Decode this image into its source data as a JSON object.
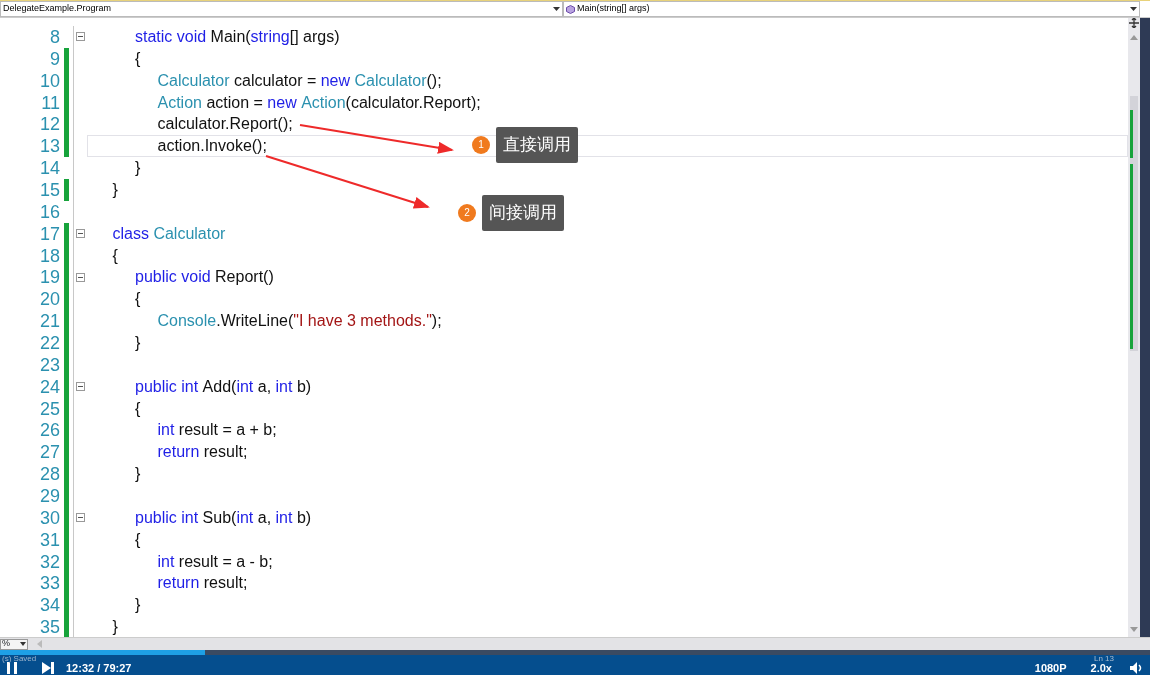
{
  "navigation_bar": {
    "type_dropdown": {
      "value": "DelegateExample.Program"
    },
    "member_dropdown": {
      "value": "Main(string[] args)"
    }
  },
  "code_lines": [
    {
      "children": [
        {
          "number": "8",
          "changed": false,
          "foldable": true,
          "current": false,
          "tokens": [
            {
              "text": "static void ",
              "kind": "keyword"
            },
            {
              "text": "Main(",
              "kind": "plain"
            },
            {
              "text": "string",
              "kind": "keyword"
            },
            {
              "text": "[] args)",
              "kind": "plain"
            }
          ]
        },
        {
          "number": "9",
          "changed": true,
          "foldable": false,
          "current": false,
          "tokens": [
            {
              "text": "{",
              "kind": "plain"
            }
          ],
          "children": [
            {
              "number": "10",
              "changed": true,
              "foldable": false,
              "current": false,
              "tokens": [
                {
                  "text": "Calculator",
                  "kind": "type"
                },
                {
                  "text": " calculator = ",
                  "kind": "plain"
                },
                {
                  "text": "new ",
                  "kind": "keyword"
                },
                {
                  "text": "Calculator",
                  "kind": "type"
                },
                {
                  "text": "();",
                  "kind": "plain"
                }
              ]
            },
            {
              "number": "11",
              "changed": true,
              "foldable": false,
              "current": false,
              "tokens": [
                {
                  "text": "Action",
                  "kind": "type"
                },
                {
                  "text": " action = ",
                  "kind": "plain"
                },
                {
                  "text": "new ",
                  "kind": "keyword"
                },
                {
                  "text": "Action",
                  "kind": "type"
                },
                {
                  "text": "(calculator.Report);",
                  "kind": "plain"
                }
              ]
            },
            {
              "number": "12",
              "changed": true,
              "foldable": false,
              "current": false,
              "tokens": [
                {
                  "text": "calculator.Report();",
                  "kind": "plain"
                }
              ]
            },
            {
              "number": "13",
              "changed": true,
              "foldable": false,
              "current": true,
              "tokens": [
                {
                  "text": "action.Invoke();",
                  "kind": "plain"
                }
              ]
            }
          ]
        },
        {
          "number": "14",
          "changed": false,
          "foldable": false,
          "current": false,
          "tokens": [
            {
              "text": "}",
              "kind": "plain"
            }
          ]
        }
      ]
    },
    {
      "number": "15",
      "changed": true,
      "foldable": false,
      "current": false,
      "tokens": [
        {
          "text": "}",
          "kind": "plain"
        }
      ]
    },
    {
      "number": "16",
      "changed": false,
      "foldable": false,
      "current": false
    },
    {
      "number": "17",
      "changed": true,
      "foldable": true,
      "current": false,
      "tokens": [
        {
          "text": "class ",
          "kind": "keyword"
        },
        {
          "text": "Calculator",
          "kind": "type"
        }
      ]
    },
    {
      "number": "18",
      "changed": true,
      "foldable": false,
      "current": false,
      "tokens": [
        {
          "text": "{",
          "kind": "plain"
        }
      ],
      "children": [
        {
          "number": "19",
          "changed": true,
          "foldable": true,
          "current": false,
          "tokens": [
            {
              "text": "public void ",
              "kind": "keyword"
            },
            {
              "text": "Report()",
              "kind": "plain"
            }
          ]
        },
        {
          "number": "20",
          "changed": true,
          "foldable": false,
          "current": false,
          "tokens": [
            {
              "text": "{",
              "kind": "plain"
            }
          ],
          "children": [
            {
              "number": "21",
              "changed": true,
              "foldable": false,
              "current": false,
              "tokens": [
                {
                  "text": "Console",
                  "kind": "type"
                },
                {
                  "text": ".WriteLine(",
                  "kind": "plain"
                },
                {
                  "text": "\"I have 3 methods.\"",
                  "kind": "string"
                },
                {
                  "text": ");",
                  "kind": "plain"
                }
              ]
            }
          ]
        },
        {
          "number": "22",
          "changed": true,
          "foldable": false,
          "current": false,
          "tokens": [
            {
              "text": "}",
              "kind": "plain"
            }
          ]
        },
        {
          "number": "23",
          "changed": true,
          "foldable": false,
          "current": false
        },
        {
          "number": "24",
          "changed": true,
          "foldable": true,
          "current": false,
          "tokens": [
            {
              "text": "public int ",
              "kind": "keyword"
            },
            {
              "text": "Add(",
              "kind": "plain"
            },
            {
              "text": "int ",
              "kind": "keyword"
            },
            {
              "text": "a, ",
              "kind": "plain"
            },
            {
              "text": "int ",
              "kind": "keyword"
            },
            {
              "text": "b)",
              "kind": "plain"
            }
          ]
        },
        {
          "number": "25",
          "changed": true,
          "foldable": false,
          "current": false,
          "tokens": [
            {
              "text": "{",
              "kind": "plain"
            }
          ],
          "children": [
            {
              "number": "26",
              "changed": true,
              "foldable": false,
              "current": false,
              "tokens": [
                {
                  "text": "int ",
                  "kind": "keyword"
                },
                {
                  "text": "result = a + b;",
                  "kind": "plain"
                }
              ]
            },
            {
              "number": "27",
              "changed": true,
              "foldable": false,
              "current": false,
              "tokens": [
                {
                  "text": "return ",
                  "kind": "keyword"
                },
                {
                  "text": "result;",
                  "kind": "plain"
                }
              ]
            }
          ]
        },
        {
          "number": "28",
          "changed": true,
          "foldable": false,
          "current": false,
          "tokens": [
            {
              "text": "}",
              "kind": "plain"
            }
          ]
        },
        {
          "number": "29",
          "changed": true,
          "foldable": false,
          "current": false
        },
        {
          "number": "30",
          "changed": true,
          "foldable": true,
          "current": false,
          "tokens": [
            {
              "text": "public int ",
              "kind": "keyword"
            },
            {
              "text": "Sub(",
              "kind": "plain"
            },
            {
              "text": "int ",
              "kind": "keyword"
            },
            {
              "text": "a, ",
              "kind": "plain"
            },
            {
              "text": "int ",
              "kind": "keyword"
            },
            {
              "text": "b)",
              "kind": "plain"
            }
          ]
        },
        {
          "number": "31",
          "changed": true,
          "foldable": false,
          "current": false,
          "tokens": [
            {
              "text": "{",
              "kind": "plain"
            }
          ],
          "children": [
            {
              "number": "32",
              "changed": true,
              "foldable": false,
              "current": false,
              "tokens": [
                {
                  "text": "int ",
                  "kind": "keyword"
                },
                {
                  "text": "result = a - b;",
                  "kind": "plain"
                }
              ]
            },
            {
              "number": "33",
              "changed": true,
              "foldable": false,
              "current": false,
              "tokens": [
                {
                  "text": "return ",
                  "kind": "keyword"
                },
                {
                  "text": "result;",
                  "kind": "plain"
                }
              ]
            }
          ]
        },
        {
          "number": "34",
          "changed": true,
          "foldable": false,
          "current": false,
          "tokens": [
            {
              "text": "}",
              "kind": "plain"
            }
          ]
        }
      ]
    },
    {
      "number": "35",
      "changed": true,
      "foldable": false,
      "current": false,
      "tokens": [
        {
          "text": "}",
          "kind": "plain"
        }
      ]
    }
  ],
  "callouts": [
    {
      "number": "1",
      "label": "直接调用"
    },
    {
      "number": "2",
      "label": "间接调用"
    }
  ],
  "zoom_dropdown": {
    "value": "%"
  },
  "player": {
    "status_text": "(s) Saved",
    "progress": {
      "level": 0.178
    },
    "time": "12:32 / 79:27",
    "quality": "1080P",
    "speed": "2.0x",
    "position": "Ln 13"
  }
}
